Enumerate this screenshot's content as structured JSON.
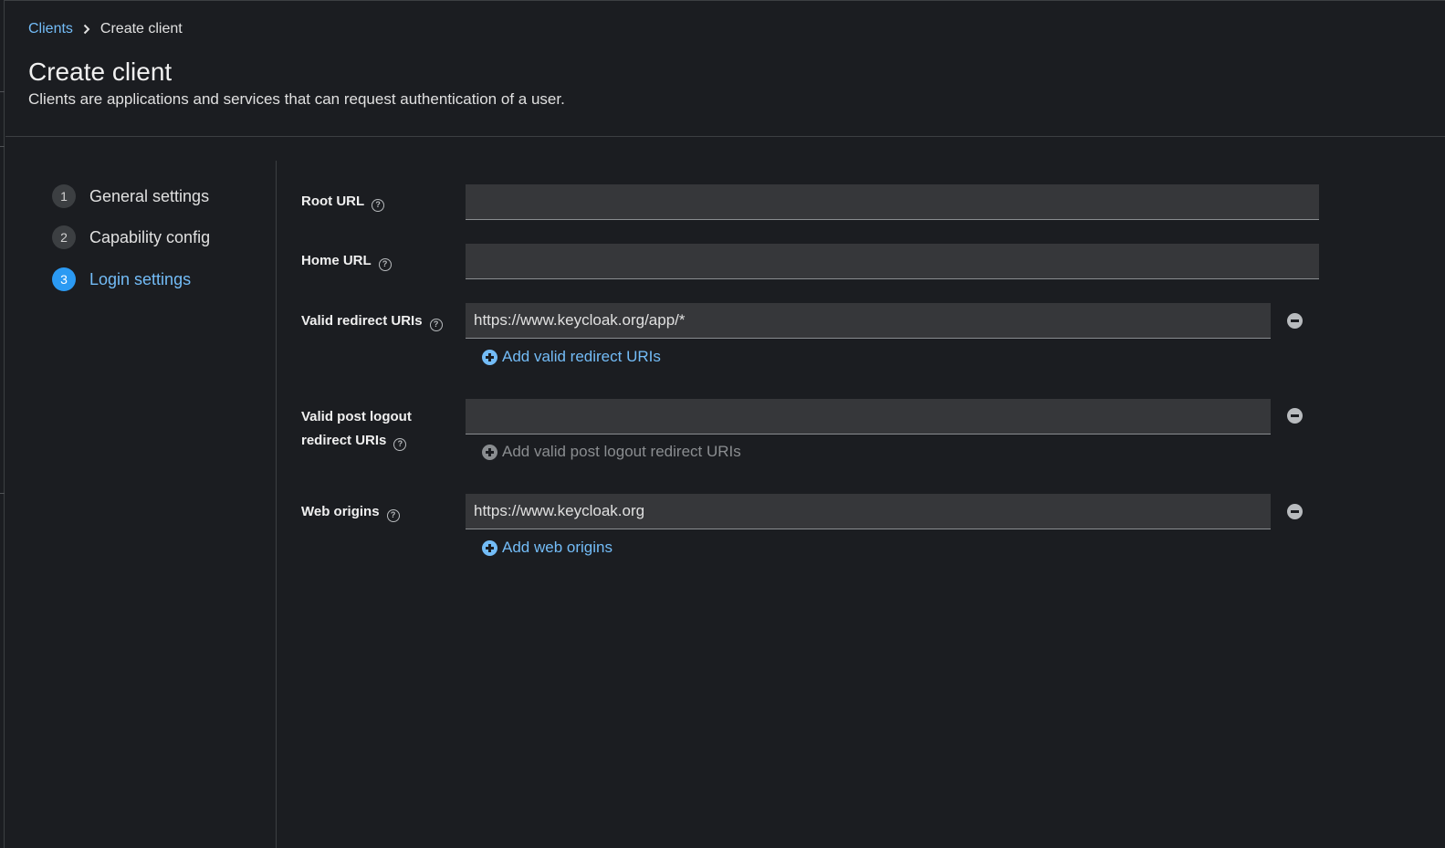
{
  "breadcrumb": {
    "items": [
      "Clients",
      "Create client"
    ]
  },
  "header": {
    "title": "Create client",
    "description": "Clients are applications and services that can request authentication of a user."
  },
  "wizard": {
    "steps": [
      {
        "number": "1",
        "label": "General settings",
        "active": false
      },
      {
        "number": "2",
        "label": "Capability config",
        "active": false
      },
      {
        "number": "3",
        "label": "Login settings",
        "active": true
      }
    ]
  },
  "form": {
    "root_url": {
      "label": "Root URL",
      "value": ""
    },
    "home_url": {
      "label": "Home URL",
      "value": ""
    },
    "valid_redirect_uris": {
      "label": "Valid redirect URIs",
      "value": "https://www.keycloak.org/app/*",
      "add_label": "Add valid redirect URIs"
    },
    "valid_post_logout_redirect_uris": {
      "label_line1": "Valid post logout",
      "label_line2": "redirect URIs",
      "value": "",
      "add_label": "Add valid post logout redirect URIs"
    },
    "web_origins": {
      "label": "Web origins",
      "value": "https://www.keycloak.org",
      "add_label": "Add web origins"
    }
  },
  "icons": {
    "help": "question-circle-icon",
    "remove": "minus-circle-icon",
    "add": "plus-circle-icon",
    "separator": "chevron-right-icon"
  },
  "colors": {
    "background": "#1b1d21",
    "accent": "#73bcf7",
    "active_step": "#2b9af3",
    "input_bg": "#36373a"
  }
}
